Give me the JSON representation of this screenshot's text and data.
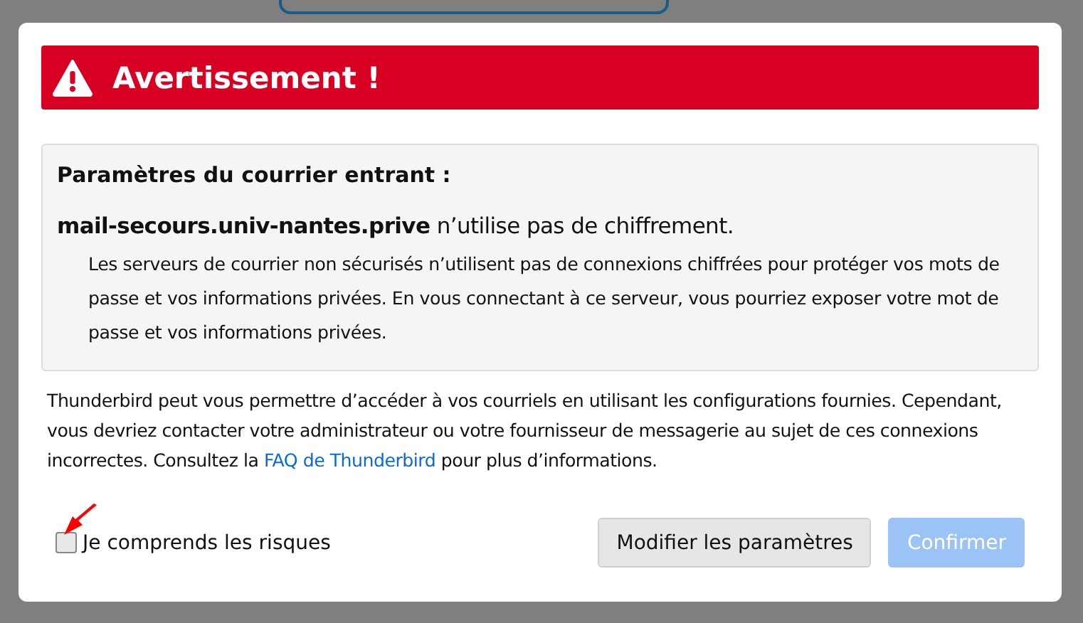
{
  "banner": {
    "title": "Avertissement !"
  },
  "incoming": {
    "heading": "Paramètres du courrier entrant :",
    "server_line": "**mail-secours.univ-nantes.prive** n’utilise pas de chiffrement.",
    "explanation": "Les serveurs de courrier non sécurisés n’utilisent pas de connexions chiffrées pour protéger vos mots de passe et vos informations privées. En vous connectant à ce serveur, vous pourriez exposer votre mot de passe et vos informations privées."
  },
  "body": {
    "before_link": "Thunderbird peut vous permettre d’accéder à vos courriels en utilisant les configurations fournies. Cependant, vous devriez contacter votre administrateur ou votre fournisseur de messagerie au sujet de ces connexions incorrectes. Consultez la",
    "link": "FAQ de Thunderbird",
    "after_link": "pour plus d’informations."
  },
  "checkbox": {
    "label": "Je comprends les risques",
    "checked": false
  },
  "buttons": [
    {
      "label": "Modifier les paramètres",
      "kind": "secondary",
      "disabled": false
    },
    {
      "label": "Confirmer",
      "kind": "primary",
      "disabled": true
    }
  ]
}
